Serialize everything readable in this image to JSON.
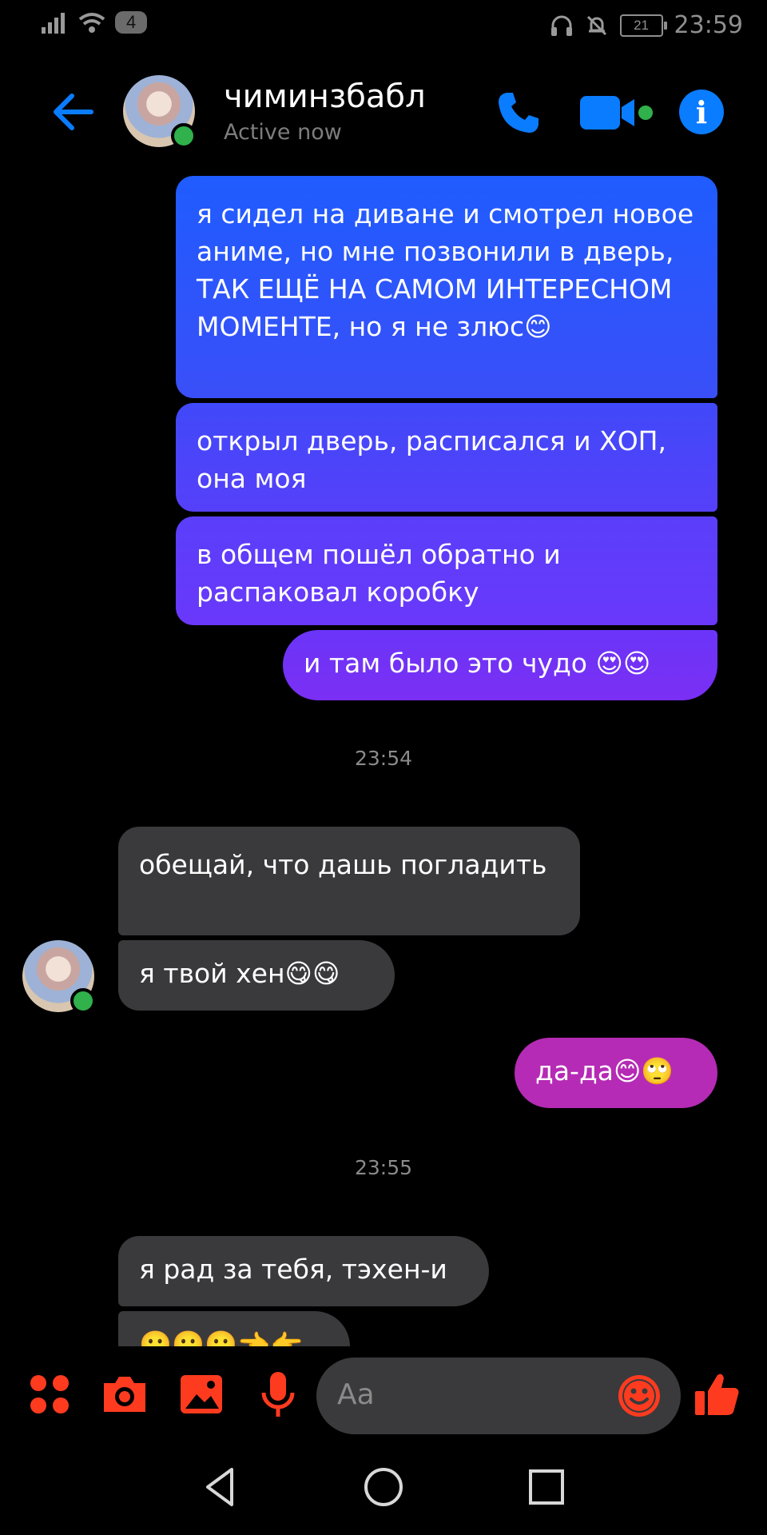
{
  "status_bar": {
    "sim_badge": "4",
    "battery": "21",
    "time": "23:59"
  },
  "header": {
    "contact_name": "чиминзбабл",
    "status": "Active now"
  },
  "messages": {
    "out1": "я сидел на диване и смотрел новое аниме, но мне позвонили в дверь, ТАК ЕЩЁ НА САМОМ ИНТЕРЕСНОМ МОМЕНТЕ, но я не злюс😊",
    "out2": "открыл дверь, расписался и ХОП, она моя",
    "out3": "в общем пошёл обратно и распаковал коробку",
    "out4": "и там было это чудо 😍😍",
    "ts1": "23:54",
    "in1": "обещай, что дашь погладить",
    "in2": "я твой хен😋😋",
    "out5": "да-да😊🙄",
    "ts2": "23:55",
    "in3": "я рад за тебя, тэхен-и",
    "in4": "🙂🙂🙂👈👉"
  },
  "composer": {
    "placeholder": "Aa"
  },
  "colors": {
    "accent_blue": "#0a7cff",
    "composer_orange": "#ff3b1f",
    "online_green": "#30b14b"
  }
}
